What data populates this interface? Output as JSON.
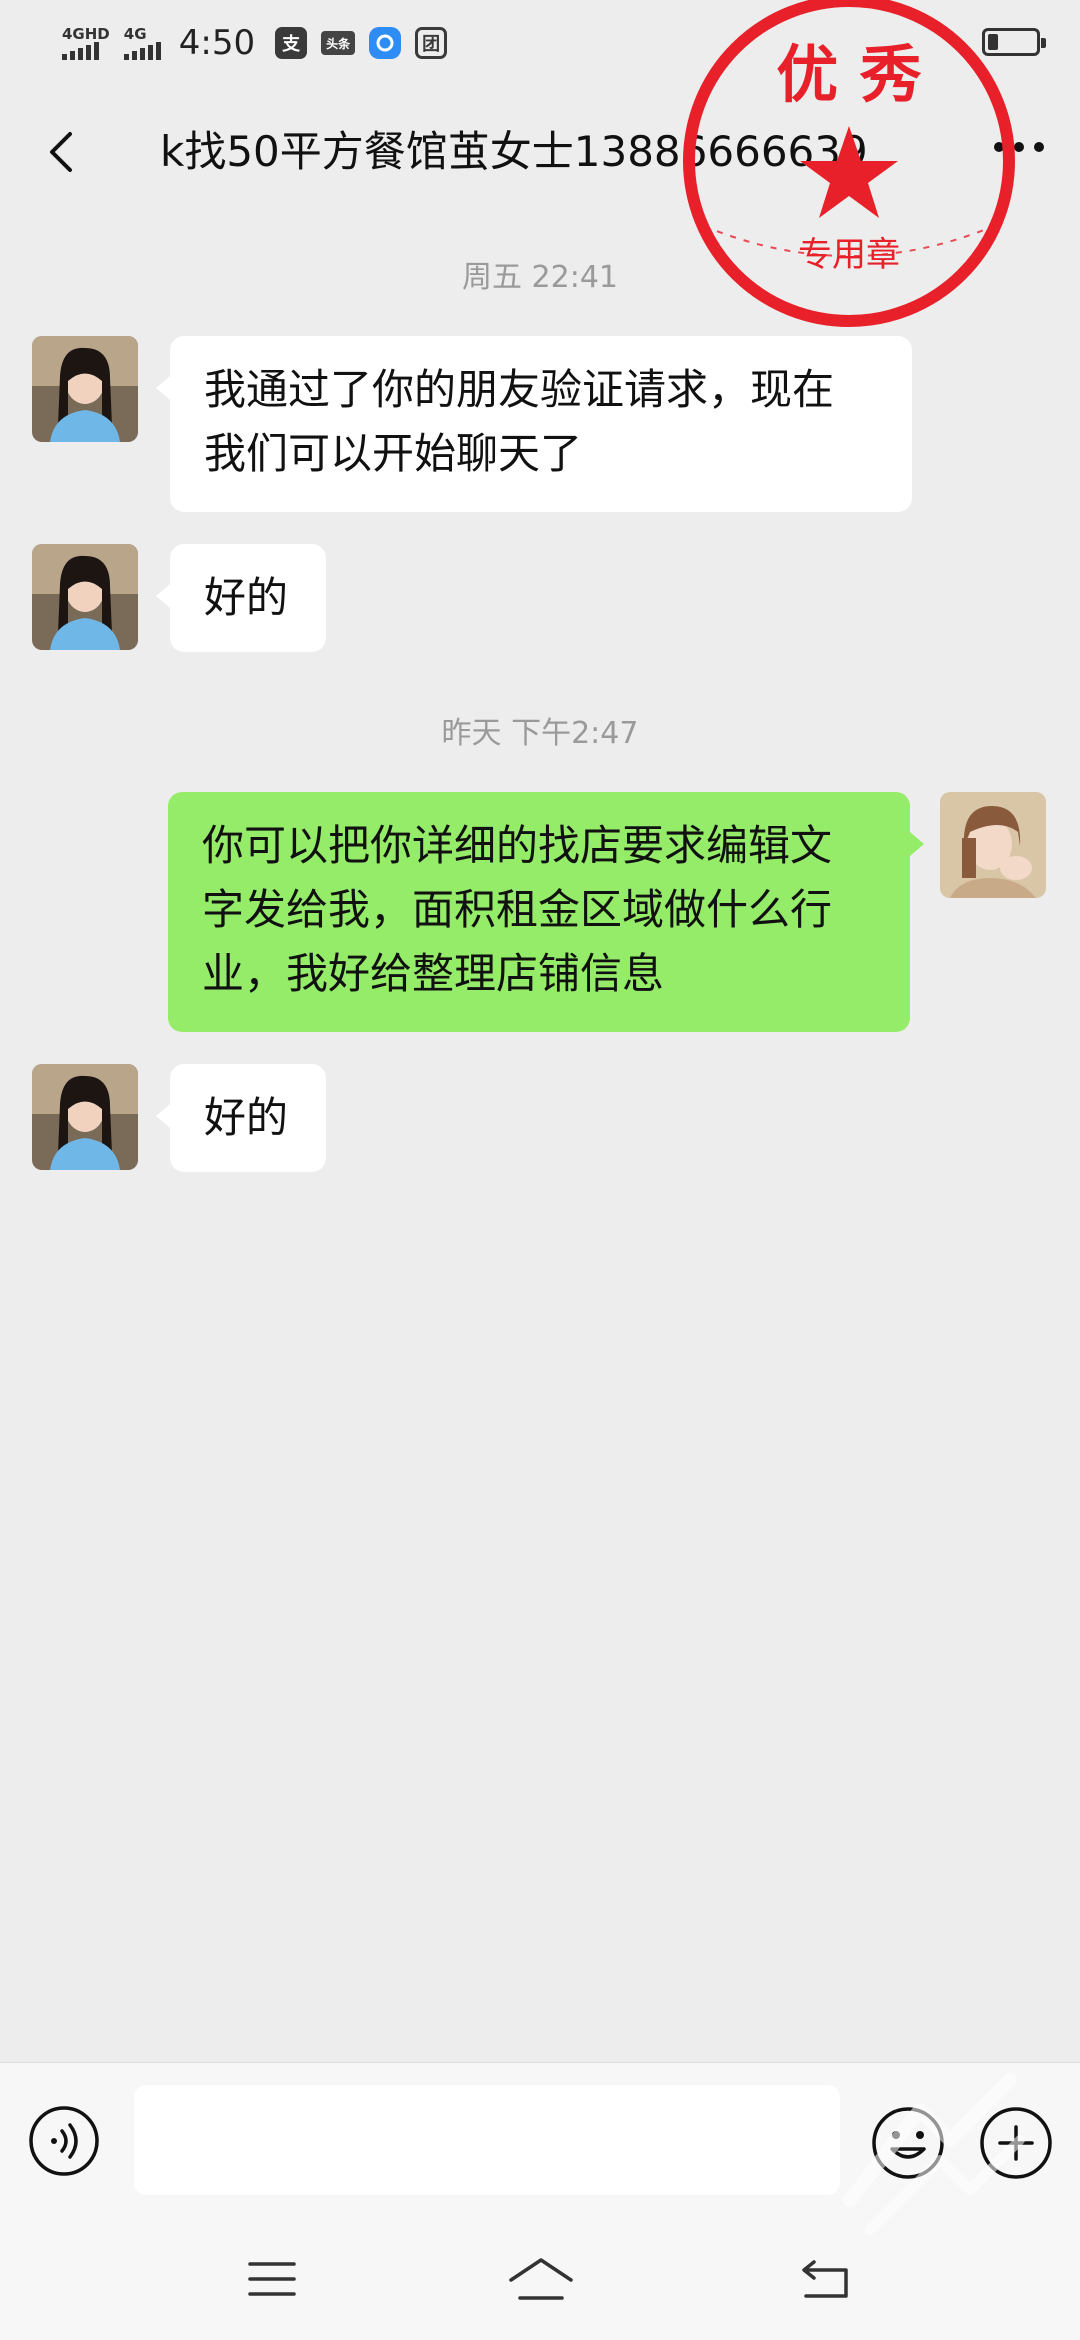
{
  "status_bar": {
    "signal1_label": "4GHD",
    "signal2_label": "4G",
    "time": "4:50",
    "icons": [
      "alipay-icon",
      "toutiao-icon",
      "app-icon",
      "meituan-icon"
    ],
    "alipay_glyph": "支",
    "toutiao_glyph": "头条",
    "meituan_glyph": "团"
  },
  "header": {
    "title": "k找50平方餐馆茧女士13886666639",
    "back_icon": "back-arrow-icon",
    "more_icon": "more-dots-icon"
  },
  "stamp": {
    "top_text": "优 秀",
    "bottom_text": "专用章",
    "color": "#e8202a"
  },
  "chat": {
    "timestamps": [
      "周五 22:41",
      "昨天 下午2:47"
    ],
    "messages": [
      {
        "side": "in",
        "text_line1": "我通过了你的朋友验证请求，现在",
        "text_line2": "我们可以开始聊天了"
      },
      {
        "side": "in",
        "text": "好的"
      },
      {
        "side": "out",
        "text_line1": "你可以把你详细的找店要求编辑文",
        "text_line2": "字发给我，面积租金区域做什么行",
        "text_line3": "业，我好给整理店铺信息"
      },
      {
        "side": "in",
        "text": "好的"
      }
    ],
    "colors": {
      "incoming_bubble": "#ffffff",
      "outgoing_bubble": "#95ec69",
      "background": "#ededed"
    }
  },
  "input_bar": {
    "value": "",
    "placeholder": "",
    "voice_icon": "voice-icon",
    "emoji_icon": "emoji-icon",
    "plus_icon": "plus-icon"
  },
  "nav_bar": {
    "icons": [
      "menu-icon",
      "home-icon",
      "back-nav-icon"
    ]
  }
}
